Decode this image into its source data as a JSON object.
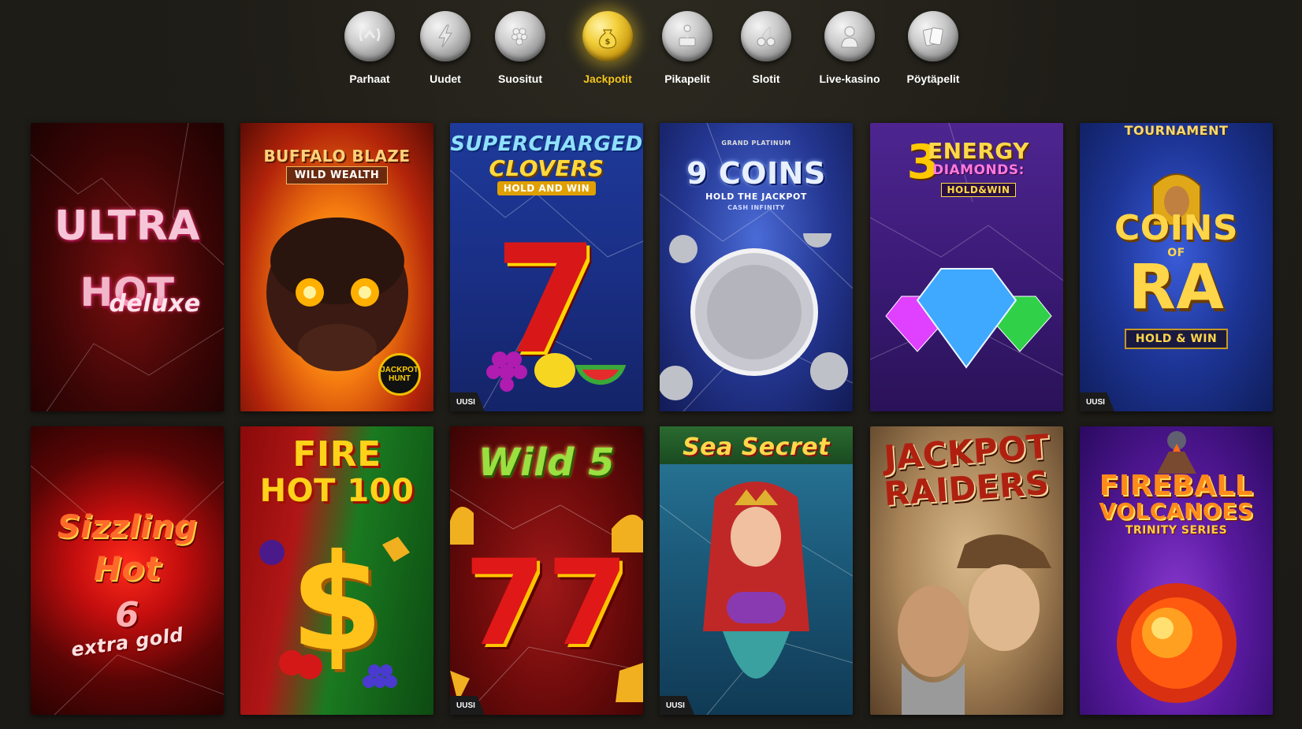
{
  "nav": {
    "items": [
      {
        "label": "Parhaat",
        "icon": "laurel-crown-icon"
      },
      {
        "label": "Uudet",
        "icon": "lightning-icon"
      },
      {
        "label": "Suositut",
        "icon": "grapes-icon"
      },
      {
        "label": "Jackpotit",
        "icon": "money-bag-icon"
      },
      {
        "label": "Pikapelit",
        "icon": "joystick-icon"
      },
      {
        "label": "Slotit",
        "icon": "cherries-icon"
      },
      {
        "label": "Live-kasino",
        "icon": "statue-bust-icon"
      },
      {
        "label": "Pöytäpelit",
        "icon": "playing-cards-icon"
      }
    ],
    "active_index": 3,
    "accent_color": "#f5c518"
  },
  "games": {
    "row1": [
      {
        "title_lines": [
          "ULTRA",
          "HOT",
          "deluxe"
        ],
        "badge": "",
        "theme": "dark-red"
      },
      {
        "title_lines": [
          "BUFFALO BLAZE",
          "WILD WEALTH"
        ],
        "extra": "JACKPOT HUNT",
        "badge": "",
        "theme": "fire"
      },
      {
        "title_lines": [
          "SUPERCHARGED",
          "CLOVERS",
          "HOLD AND WIN"
        ],
        "badge": "UUSI",
        "theme": "blue"
      },
      {
        "title_lines": [
          "GRAND PLATINUM",
          "9 COINS",
          "HOLD THE JACKPOT",
          "CASH INFINITY"
        ],
        "badge": "",
        "theme": "navy"
      },
      {
        "title_lines": [
          "3",
          "ENERGY",
          "DIAMONDS:",
          "HOLD&WIN"
        ],
        "badge": "",
        "theme": "purple"
      },
      {
        "title_lines": [
          "TOURNAMENT",
          "COINS",
          "OF",
          "RA",
          "HOLD & WIN"
        ],
        "badge": "UUSI",
        "theme": "royal-blue"
      }
    ],
    "row2": [
      {
        "title_lines": [
          "Sizzling",
          "Hot",
          "6",
          "extra gold"
        ],
        "badge": "",
        "theme": "crimson"
      },
      {
        "title_lines": [
          "FIRE",
          "HOT 100"
        ],
        "badge": "",
        "theme": "green-red"
      },
      {
        "title_lines": [
          "Wild 5"
        ],
        "badge": "UUSI",
        "theme": "maroon"
      },
      {
        "title_lines": [
          "Sea Secret"
        ],
        "badge": "UUSI",
        "theme": "ocean"
      },
      {
        "title_lines": [
          "JACKPOT",
          "RAIDERS"
        ],
        "badge": "",
        "theme": "sepia"
      },
      {
        "title_lines": [
          "FIREBALL",
          "VOLCANOES",
          "TRINITY SERIES"
        ],
        "badge": "",
        "theme": "violet"
      }
    ]
  }
}
